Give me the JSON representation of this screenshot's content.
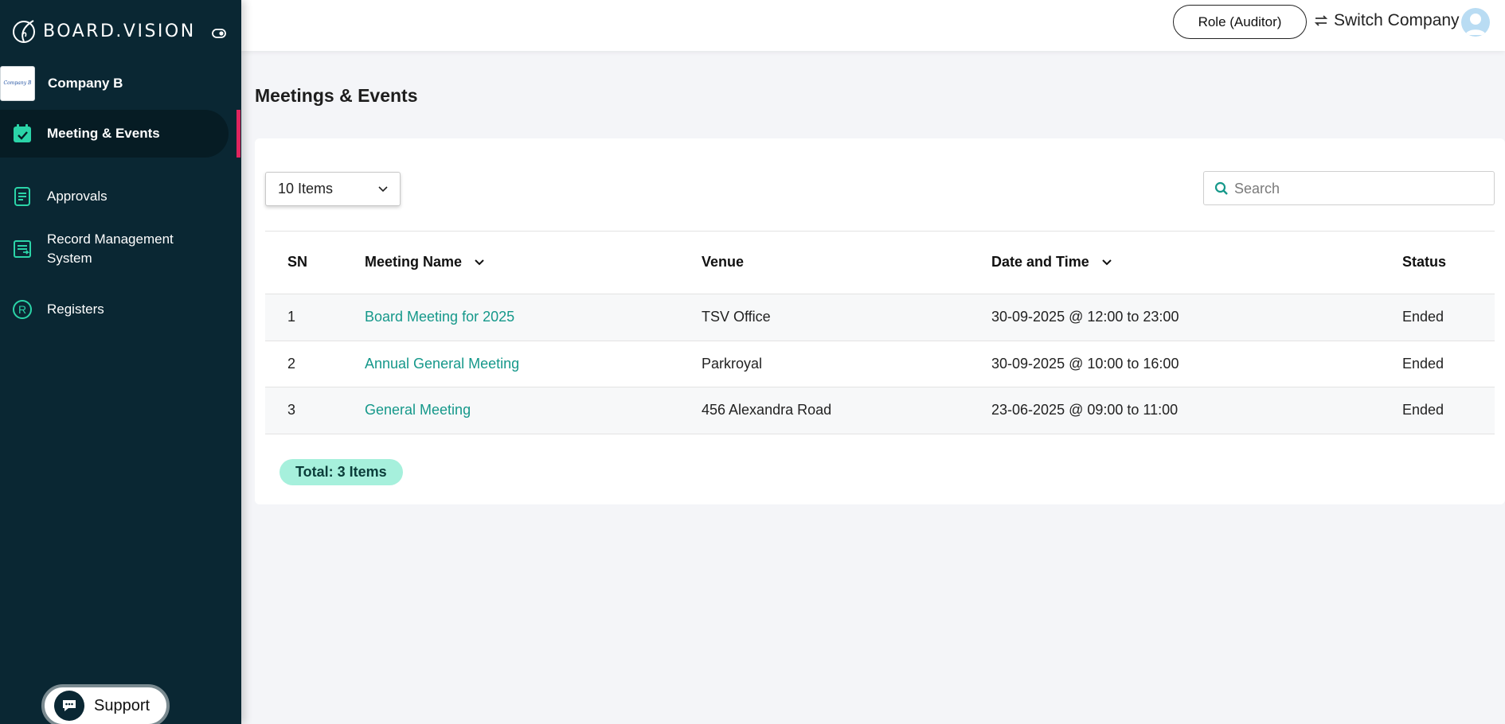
{
  "brand": {
    "name": "BOARD.VISION"
  },
  "company": {
    "logo_text": "Company B",
    "name": "Company B"
  },
  "sidebar": {
    "items": [
      {
        "label": "Meeting & Events",
        "icon": "calendar-check-icon",
        "active": true
      },
      {
        "label": "Approvals",
        "icon": "document-icon"
      },
      {
        "label": "Record Management System",
        "icon": "record-icon"
      },
      {
        "label": "Registers",
        "icon": "registered-icon"
      }
    ],
    "support_label": "Support"
  },
  "header": {
    "role_label": "Role (Auditor)",
    "switch_label": "Switch Company"
  },
  "main": {
    "title": "Meetings & Events",
    "page_size": "10 Items",
    "search_placeholder": "Search",
    "columns": [
      "SN",
      "Meeting Name",
      "Venue",
      "Date and Time",
      "Status"
    ],
    "rows": [
      {
        "sn": "1",
        "name": "Board Meeting for 2025",
        "venue": "TSV Office",
        "datetime": "30-09-2025 @ 12:00 to 23:00",
        "status": "Ended"
      },
      {
        "sn": "2",
        "name": "Annual General Meeting",
        "venue": "Parkroyal",
        "datetime": "30-09-2025 @ 10:00 to 16:00",
        "status": "Ended"
      },
      {
        "sn": "3",
        "name": "General Meeting",
        "venue": "456 Alexandra Road",
        "datetime": "23-06-2025 @ 09:00 to 11:00",
        "status": "Ended"
      }
    ],
    "total_label": "Total: 3 Items"
  },
  "colors": {
    "sidebar": "#0a2733",
    "accent": "#15988a",
    "active_bar": "#e0245e",
    "total_badge": "#a6f0dc"
  }
}
